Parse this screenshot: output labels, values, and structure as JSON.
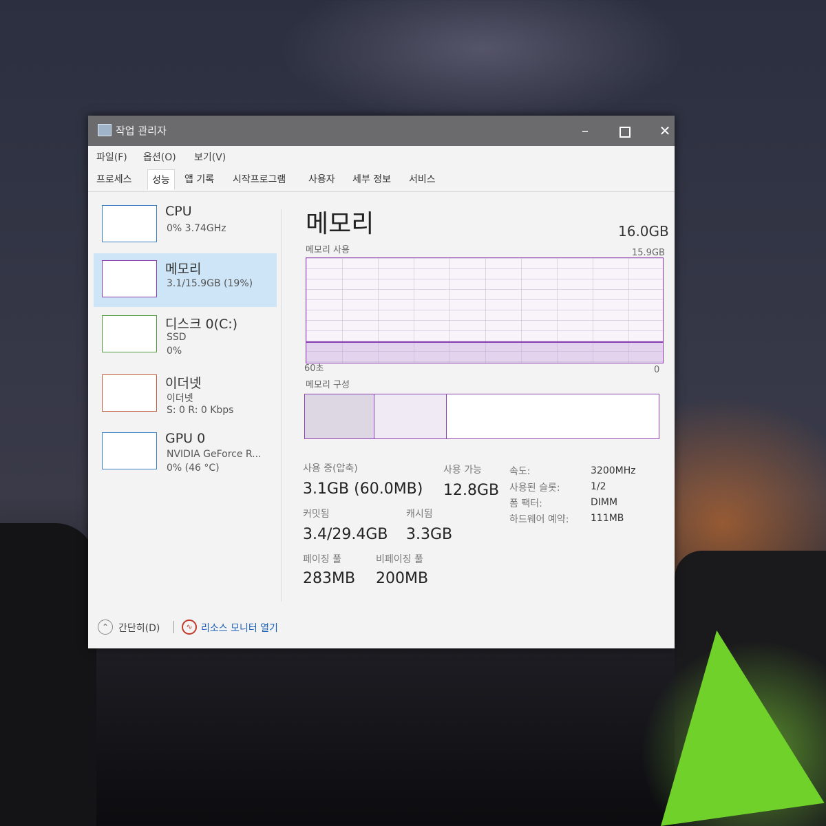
{
  "window": {
    "title": "작업 관리자",
    "min": "–",
    "close": "✕"
  },
  "menu": [
    "파일(F)",
    "옵션(O)",
    "보기(V)"
  ],
  "tabs": [
    "프로세스",
    "성능",
    "앱 기록",
    "시작프로그램",
    "사용자",
    "세부 정보",
    "서비스"
  ],
  "active_tab": "성능",
  "sidebar": {
    "cpu": {
      "title": "CPU",
      "sub1": "0% 3.74GHz"
    },
    "memory": {
      "title": "메모리",
      "sub1": "3.1/15.9GB (19%)"
    },
    "disk": {
      "title": "디스크 0(C:)",
      "sub1": "SSD",
      "sub2": "0%"
    },
    "ethernet": {
      "title": "이더넷",
      "sub1": "이더넷",
      "sub2": "S: 0 R: 0 Kbps"
    },
    "gpu": {
      "title": "GPU 0",
      "sub1": "NVIDIA GeForce R...",
      "sub2": "0% (46 °C)"
    }
  },
  "memory_panel": {
    "title": "메모리",
    "total": "16.0GB",
    "usage_label": "메모리 사용",
    "usage_max": "15.9GB",
    "usage_percent": 19,
    "time_left": "60초",
    "time_right": "0",
    "composition_label": "메모리 구성",
    "in_use_label": "사용 중(압축)",
    "in_use_value": "3.1GB (60.0MB)",
    "available_label": "사용 가능",
    "available_value": "12.8GB",
    "committed_label": "커밋됨",
    "committed_value": "3.4/29.4GB",
    "cached_label": "캐시됨",
    "cached_value": "3.3GB",
    "paged_label": "페이징 풀",
    "paged_value": "283MB",
    "nonpaged_label": "비페이징 풀",
    "nonpaged_value": "200MB",
    "details": [
      {
        "label": "속도:",
        "value": "3200MHz"
      },
      {
        "label": "사용된 슬롯:",
        "value": "1/2"
      },
      {
        "label": "폼 팩터:",
        "value": "DIMM"
      },
      {
        "label": "하드웨어 예약:",
        "value": "111MB"
      }
    ]
  },
  "footer": {
    "fewer_details": "간단히(D)",
    "open_monitor": "리소스 모니터 열기"
  },
  "colors": {
    "memory_accent": "#8b3fb0",
    "selection": "#cde5f7",
    "link": "#1a5fb4"
  }
}
